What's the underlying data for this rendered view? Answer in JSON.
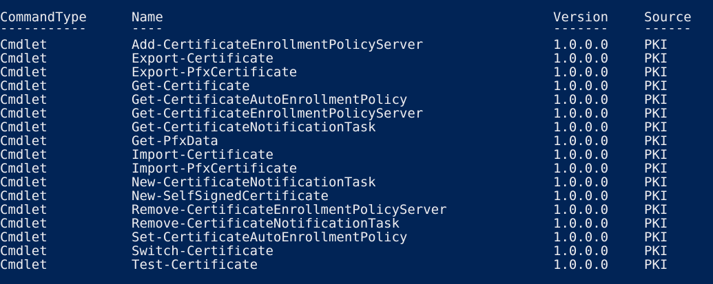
{
  "headers": {
    "command_type": "CommandType",
    "name": "Name",
    "version": "Version",
    "source": "Source"
  },
  "separators": {
    "command_type": "-----------",
    "name": "----",
    "version": "-------",
    "source": "------"
  },
  "rows": [
    {
      "type": "Cmdlet",
      "name": "Add-CertificateEnrollmentPolicyServer",
      "version": "1.0.0.0",
      "source": "PKI"
    },
    {
      "type": "Cmdlet",
      "name": "Export-Certificate",
      "version": "1.0.0.0",
      "source": "PKI"
    },
    {
      "type": "Cmdlet",
      "name": "Export-PfxCertificate",
      "version": "1.0.0.0",
      "source": "PKI"
    },
    {
      "type": "Cmdlet",
      "name": "Get-Certificate",
      "version": "1.0.0.0",
      "source": "PKI"
    },
    {
      "type": "Cmdlet",
      "name": "Get-CertificateAutoEnrollmentPolicy",
      "version": "1.0.0.0",
      "source": "PKI"
    },
    {
      "type": "Cmdlet",
      "name": "Get-CertificateEnrollmentPolicyServer",
      "version": "1.0.0.0",
      "source": "PKI"
    },
    {
      "type": "Cmdlet",
      "name": "Get-CertificateNotificationTask",
      "version": "1.0.0.0",
      "source": "PKI"
    },
    {
      "type": "Cmdlet",
      "name": "Get-PfxData",
      "version": "1.0.0.0",
      "source": "PKI"
    },
    {
      "type": "Cmdlet",
      "name": "Import-Certificate",
      "version": "1.0.0.0",
      "source": "PKI"
    },
    {
      "type": "Cmdlet",
      "name": "Import-PfxCertificate",
      "version": "1.0.0.0",
      "source": "PKI"
    },
    {
      "type": "Cmdlet",
      "name": "New-CertificateNotificationTask",
      "version": "1.0.0.0",
      "source": "PKI"
    },
    {
      "type": "Cmdlet",
      "name": "New-SelfSignedCertificate",
      "version": "1.0.0.0",
      "source": "PKI"
    },
    {
      "type": "Cmdlet",
      "name": "Remove-CertificateEnrollmentPolicyServer",
      "version": "1.0.0.0",
      "source": "PKI"
    },
    {
      "type": "Cmdlet",
      "name": "Remove-CertificateNotificationTask",
      "version": "1.0.0.0",
      "source": "PKI"
    },
    {
      "type": "Cmdlet",
      "name": "Set-CertificateAutoEnrollmentPolicy",
      "version": "1.0.0.0",
      "source": "PKI"
    },
    {
      "type": "Cmdlet",
      "name": "Switch-Certificate",
      "version": "1.0.0.0",
      "source": "PKI"
    },
    {
      "type": "Cmdlet",
      "name": "Test-Certificate",
      "version": "1.0.0.0",
      "source": "PKI"
    }
  ],
  "colors": {
    "background": "#012456",
    "foreground": "#eeedf0"
  }
}
